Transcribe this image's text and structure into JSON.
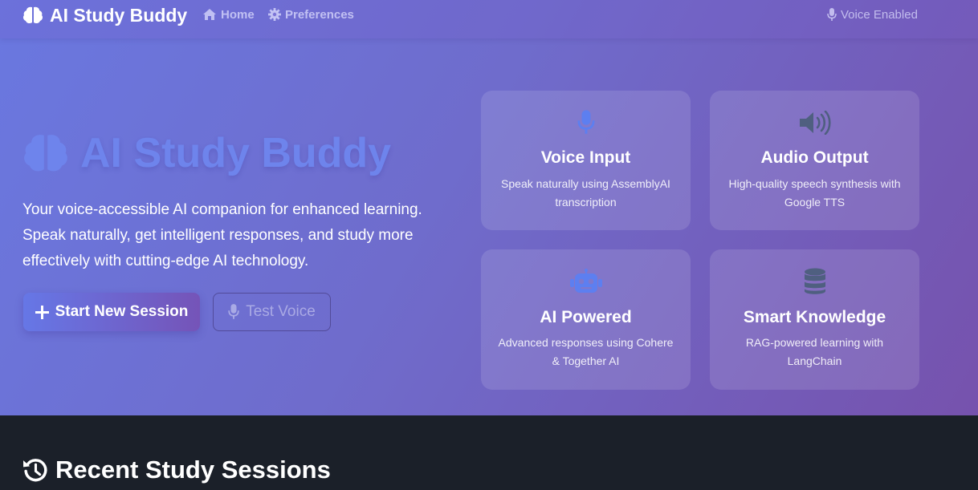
{
  "colors": {
    "hero_gradient_start": "#6a78e0",
    "hero_gradient_end": "#7652ad",
    "hero_title_color": "#6e84ec",
    "dark_section": "#1b2029",
    "mic_icon_color": "#5d7ff0",
    "robot_icon_color": "#5d7ff0",
    "speaker_icon_color": "#4f5f80",
    "database_icon_color": "#4f5f80"
  },
  "navbar": {
    "brand_icon": "brain-icon",
    "brand_label": "AI Study Buddy",
    "home_icon": "home-icon",
    "home_label": "Home",
    "prefs_icon": "gear-icon",
    "prefs_label": "Preferences",
    "voice_icon": "microphone-icon",
    "voice_label": "Voice Enabled"
  },
  "hero": {
    "title_icon": "brain-icon",
    "title": "AI Study Buddy",
    "description": "Your voice-accessible AI companion for enhanced learning. Speak naturally, get intelligent responses, and study more effectively with cutting-edge AI technology.",
    "primary_button_icon": "plus-icon",
    "primary_button_label": "Start New Session",
    "secondary_button_icon": "microphone-icon",
    "secondary_button_label": "Test Voice"
  },
  "features": [
    {
      "icon": "microphone-icon",
      "title": "Voice Input",
      "text": "Speak naturally using AssemblyAI transcription"
    },
    {
      "icon": "speaker-icon",
      "title": "Audio Output",
      "text": "High-quality speech synthesis with Google TTS"
    },
    {
      "icon": "robot-icon",
      "title": "AI Powered",
      "text": "Advanced responses using Cohere & Together AI"
    },
    {
      "icon": "database-icon",
      "title": "Smart Knowledge",
      "text": "RAG-powered learning with LangChain"
    }
  ],
  "recent": {
    "icon": "history-icon",
    "title": "Recent Study Sessions"
  }
}
